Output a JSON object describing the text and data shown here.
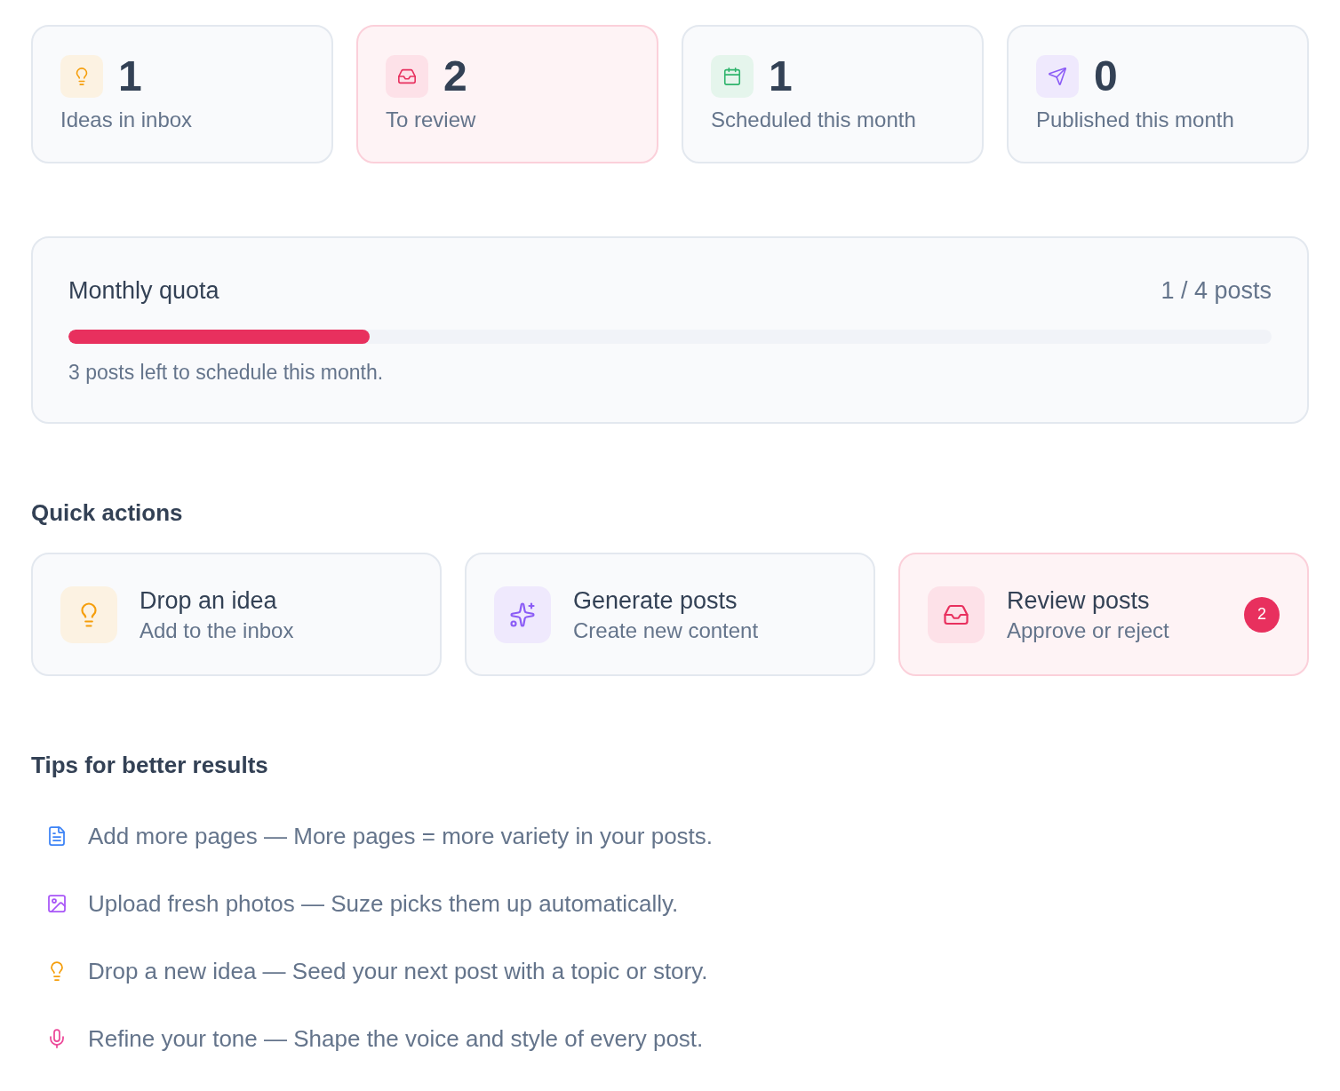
{
  "stats": [
    {
      "kind": "ideas",
      "value": "1",
      "label": "Ideas in inbox",
      "highlighted": false
    },
    {
      "kind": "review",
      "value": "2",
      "label": "To review",
      "highlighted": true
    },
    {
      "kind": "scheduled",
      "value": "1",
      "label": "Scheduled this month",
      "highlighted": false
    },
    {
      "kind": "published",
      "value": "0",
      "label": "Published this month",
      "highlighted": false
    }
  ],
  "quota": {
    "title": "Monthly quota",
    "reading": "1 / 4 posts",
    "level": 0.25,
    "note": "3 posts left to schedule this month."
  },
  "quick_actions": {
    "title": "Quick actions",
    "items": [
      {
        "kind": "idea",
        "title": "Drop an idea",
        "subtitle": "Add to the inbox",
        "highlighted": false
      },
      {
        "kind": "generate",
        "title": "Generate posts",
        "subtitle": "Create new content",
        "highlighted": false
      },
      {
        "kind": "review",
        "title": "Review posts",
        "subtitle": "Approve or reject",
        "highlighted": true,
        "badge": "2"
      }
    ]
  },
  "tips": {
    "title": "Tips for better results",
    "items": [
      {
        "kind": "pages",
        "text": "Add more pages — More pages = more variety in your posts."
      },
      {
        "kind": "photos",
        "text": "Upload fresh photos — Suze picks them up automatically."
      },
      {
        "kind": "idea",
        "text": "Drop a new idea — Seed your next post with a topic or story."
      },
      {
        "kind": "tone",
        "text": "Refine your tone — Shape the voice and style of every post."
      }
    ]
  }
}
